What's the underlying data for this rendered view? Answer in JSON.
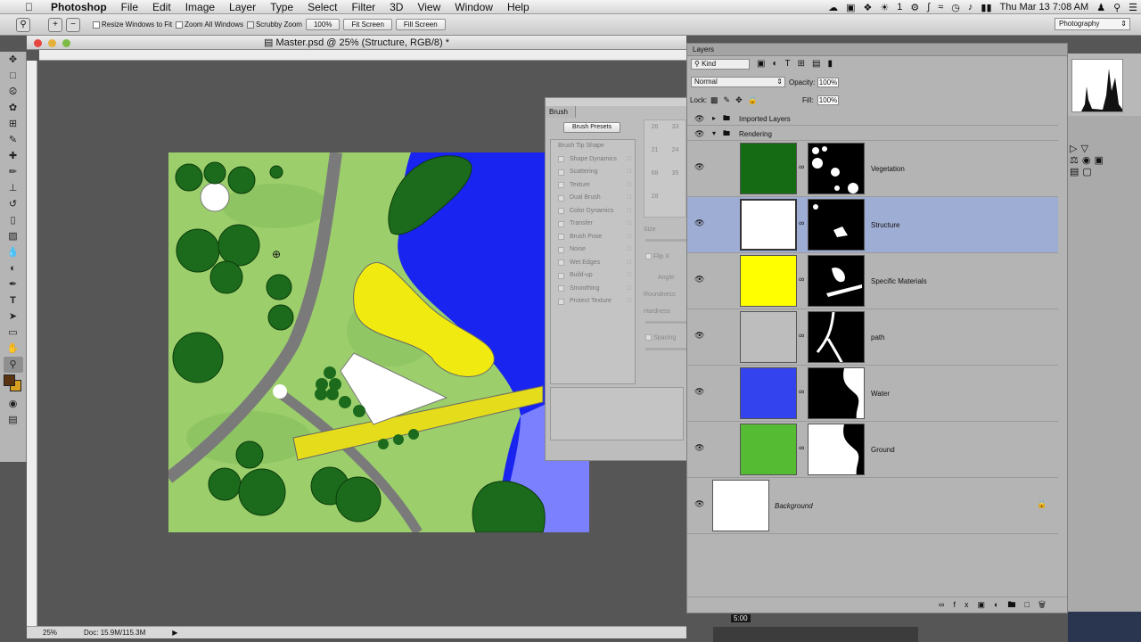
{
  "menubar": {
    "app_name": "Photoshop",
    "items": [
      "File",
      "Edit",
      "Image",
      "Layer",
      "Type",
      "Select",
      "Filter",
      "3D",
      "View",
      "Window",
      "Help"
    ],
    "tray_count": "1",
    "clock": "Thu Mar 13  7:08 AM"
  },
  "options_bar": {
    "resize_windows_label": "Resize Windows to Fit",
    "zoom_all_label": "Zoom All Windows",
    "scrubby_label": "Scrubby Zoom",
    "zoom_100_label": "100%",
    "fit_screen_label": "Fit Screen",
    "fill_screen_label": "Fill Screen",
    "workspace": "Photography"
  },
  "document": {
    "title": "Master.psd @ 25% (Structure, RGB/8) *",
    "zoom": "25%",
    "doc_size": "Doc: 15.9M/115.3M"
  },
  "brush_panel": {
    "tab": "Brush",
    "presets_button": "Brush Presets",
    "options": [
      "Brush Tip Shape",
      "Shape Dynamics",
      "Scattering",
      "Texture",
      "Dual Brush",
      "Color Dynamics",
      "Transfer",
      "Brush Pose",
      "Noise",
      "Wet Edges",
      "Build-up",
      "Smoothing",
      "Protect Texture"
    ],
    "size_label": "Size",
    "flip_label": "Flip X",
    "angle_label": "Angle:",
    "roundness_label": "Roundness:",
    "hardness_label": "Hardness",
    "spacing_label": "Spacing",
    "tip_sizes": [
      "26",
      "33",
      "21",
      "24",
      "68",
      "35",
      "28"
    ]
  },
  "layers_panel": {
    "tab": "Layers",
    "kind_label": "Kind",
    "blend_mode": "Normal",
    "opacity_label": "Opacity:",
    "opacity_value": "100%",
    "lock_label": "Lock:",
    "fill_label": "Fill:",
    "fill_value": "100%",
    "groups": [
      "Imported Layers",
      "Rendering"
    ],
    "layers": [
      {
        "name": "Vegetation",
        "color": "#146b14"
      },
      {
        "name": "Structure",
        "color": "#ffffff"
      },
      {
        "name": "Specific Materials",
        "color": "#ffff00"
      },
      {
        "name": "path",
        "color": "#bdbdbd"
      },
      {
        "name": "Water",
        "color": "#3344ee"
      },
      {
        "name": "Ground",
        "color": "#55bb33"
      }
    ],
    "background_name": "Background"
  },
  "dock": {
    "time_badge": "5:00"
  },
  "colors": {
    "foreground": "#5a3310",
    "background": "#d8a020",
    "selected_layer": "#9eadd3"
  }
}
